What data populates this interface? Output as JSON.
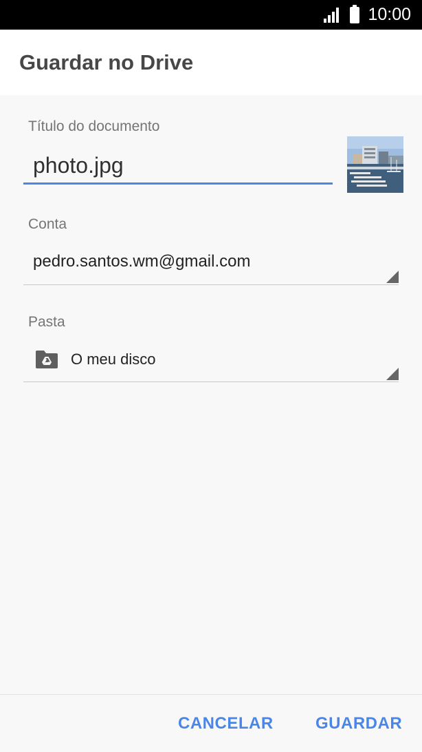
{
  "status_bar": {
    "time": "10:00",
    "signal_icon": "signal-icon",
    "battery_icon": "battery-icon"
  },
  "app_bar": {
    "title": "Guardar no Drive"
  },
  "form": {
    "title_label": "Título do documento",
    "title_value": "photo.jpg",
    "thumbnail_icon": "photo-thumbnail",
    "account_label": "Conta",
    "account_value": "pedro.santos.wm@gmail.com",
    "folder_label": "Pasta",
    "folder_icon": "drive-folder-icon",
    "folder_value": "O meu disco"
  },
  "actions": {
    "cancel_label": "CANCELAR",
    "save_label": "GUARDAR"
  },
  "colors": {
    "accent": "#4a86e8",
    "appbar_bg": "#ffffff",
    "content_bg": "#f8f8f8",
    "title_text": "#474747"
  }
}
